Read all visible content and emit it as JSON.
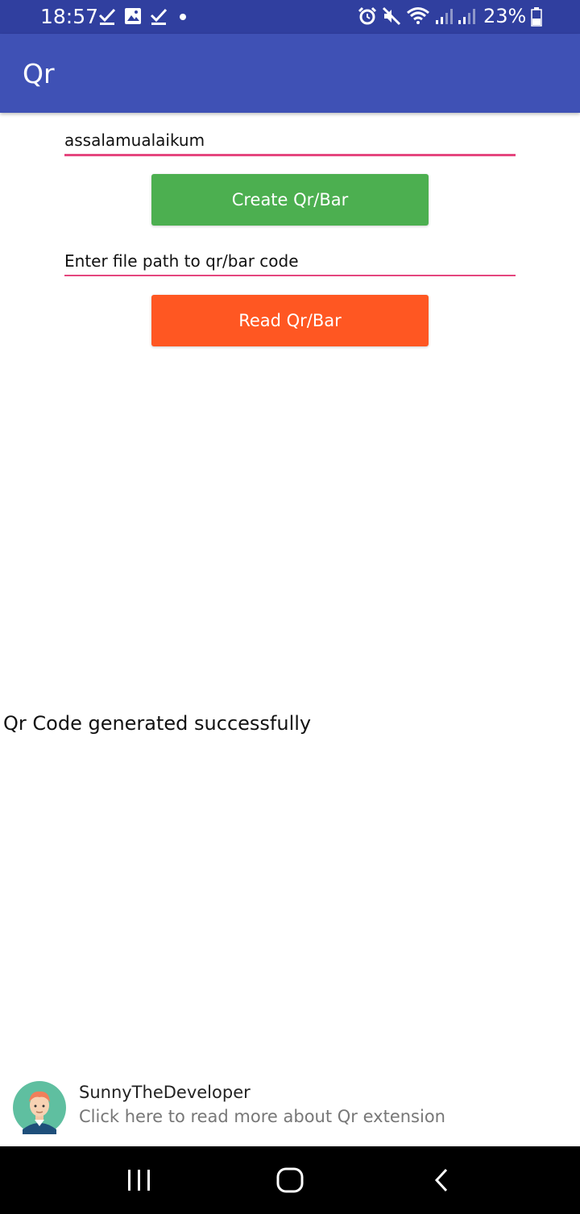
{
  "status_bar": {
    "time": "18:57",
    "battery_percent": "23%",
    "left_icons": [
      "check-icon",
      "image-icon",
      "check-icon",
      "dot-icon"
    ],
    "right_icons": [
      "alarm-icon",
      "mute-icon",
      "wifi-icon",
      "signal-icon",
      "signal-icon",
      "battery-icon"
    ]
  },
  "app_bar": {
    "title": "Qr"
  },
  "main": {
    "text_input": {
      "value": "assalamualaikum"
    },
    "create_button_label": "Create Qr/Bar",
    "file_path_input": {
      "placeholder": "Enter file path to qr/bar code"
    },
    "read_button_label": "Read Qr/Bar",
    "status_message": "Qr Code generated successfully"
  },
  "credit": {
    "name": "SunnyTheDeveloper",
    "subtitle": "Click here to read more about Qr extension",
    "avatar_icon": "developer-avatar"
  },
  "nav_bar": {
    "icons": [
      "recents-icon",
      "home-icon",
      "back-icon"
    ]
  },
  "colors": {
    "status_bar": "#303f9f",
    "app_bar": "#3f51b5",
    "create_button": "#4caf50",
    "read_button": "#ff5722",
    "input_underline": "#e5467e",
    "nav_bar": "#000000"
  }
}
